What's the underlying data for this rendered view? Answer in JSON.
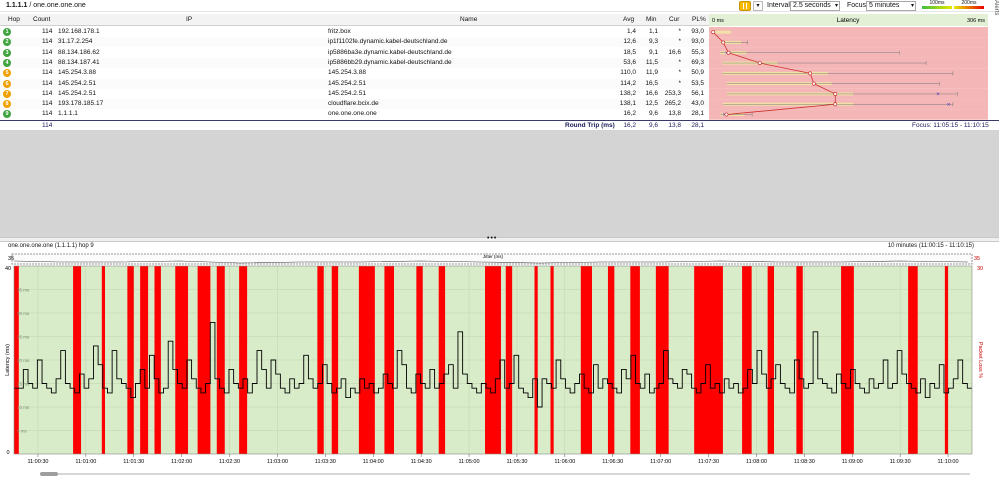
{
  "topbar": {
    "target": "1.1.1.1",
    "separator": " / ",
    "hostname": "one.one.one.one",
    "interval_label": "Interval",
    "interval_value": "2.5 seconds",
    "focus_label": "Focus",
    "focus_value": "5 minutes",
    "scale_100": "100ms",
    "scale_200": "200ms",
    "side_tab": "Alerts"
  },
  "table": {
    "headers": {
      "hop": "Hop",
      "count": "Count",
      "ip": "IP",
      "name": "Name",
      "avg": "Avg",
      "min": "Min",
      "cur": "Cur",
      "pl": "PL%"
    },
    "rows": [
      {
        "hop": "1",
        "count": "114",
        "ip": "192.168.178.1",
        "name": "fritz.box",
        "avg": "1,4",
        "min": "1,1",
        "cur": "*",
        "pl": "93,0",
        "color": "#3fa33f"
      },
      {
        "hop": "2",
        "count": "114",
        "ip": "31.17.2.254",
        "name": "ip1f1102fe.dynamic.kabel-deutschland.de",
        "avg": "12,6",
        "min": "9,3",
        "cur": "*",
        "pl": "93,0",
        "color": "#3fa33f"
      },
      {
        "hop": "3",
        "count": "114",
        "ip": "88.134.186.62",
        "name": "ip5886ba3e.dynamic.kabel-deutschland.de",
        "avg": "18,5",
        "min": "9,1",
        "cur": "16,6",
        "pl": "55,3",
        "color": "#3fa33f"
      },
      {
        "hop": "4",
        "count": "114",
        "ip": "88.134.187.41",
        "name": "ip5886bb29.dynamic.kabel-deutschland.de",
        "avg": "53,6",
        "min": "11,5",
        "cur": "*",
        "pl": "69,3",
        "color": "#3fa33f"
      },
      {
        "hop": "5",
        "count": "114",
        "ip": "145.254.3.88",
        "name": "145.254.3.88",
        "avg": "110,0",
        "min": "11,9",
        "cur": "*",
        "pl": "50,9",
        "color": "#f0a000"
      },
      {
        "hop": "6",
        "count": "114",
        "ip": "145.254.2.51",
        "name": "145.254.2.51",
        "avg": "114,2",
        "min": "16,5",
        "cur": "*",
        "pl": "53,5",
        "color": "#f0a000"
      },
      {
        "hop": "7",
        "count": "114",
        "ip": "145.254.2.51",
        "name": "145.254.2.51",
        "avg": "138,2",
        "min": "16,6",
        "cur": "253,3",
        "pl": "56,1",
        "color": "#f0a000"
      },
      {
        "hop": "8",
        "count": "114",
        "ip": "193.178.185.17",
        "name": "cloudflare.bcix.de",
        "avg": "138,1",
        "min": "12,5",
        "cur": "265,2",
        "pl": "43,0",
        "color": "#f0a000"
      },
      {
        "hop": "9",
        "count": "114",
        "ip": "1.1.1.1",
        "name": "one.one.one.one",
        "avg": "16,2",
        "min": "9,6",
        "cur": "13,8",
        "pl": "28,1",
        "color": "#3fa33f"
      }
    ],
    "footer": {
      "count": "114",
      "label": "Round Trip (ms)",
      "avg": "16,2",
      "min": "9,6",
      "cur": "13,8",
      "pl": "28,1",
      "focus_text": "Focus: 11:05:15 - 11:10:15"
    }
  },
  "latency_panel": {
    "min_label": "0 ms",
    "title": "Latency",
    "max_label": "306 ms",
    "max_ms": 306,
    "hop_avg_ms": [
      1.4,
      12.6,
      18.5,
      53.6,
      110.0,
      114.2,
      138.2,
      138.1,
      16.2
    ],
    "hop_min_ms": [
      1.1,
      9.3,
      9.1,
      11.5,
      11.9,
      16.5,
      16.6,
      12.5,
      9.6
    ],
    "hop_max_ms": [
      3,
      40,
      210,
      240,
      270,
      255,
      275,
      270,
      45
    ],
    "hop_cur_ms": [
      null,
      null,
      16.6,
      null,
      null,
      null,
      253.3,
      265.2,
      13.8
    ]
  },
  "graph": {
    "title": "one.one.one.one (1.1.1.1) hop 9",
    "range": "10 minutes (11:00:15 - 11:10:15)",
    "jitter_label": "Jitter (ms)",
    "jitter_max": "35",
    "y_left_label": "Latency (ms)",
    "y_right_label": "Packet Loss %",
    "y_top": "40",
    "y_bottom": "0",
    "y_right_top": "30",
    "y_ticks": [
      "35 ms",
      "30 ms",
      "25 ms",
      "20 ms",
      "15 ms",
      "10 ms",
      "5 ms"
    ],
    "time_labels": [
      "11:00:30",
      "11:01:00",
      "11:01:30",
      "11:02:00",
      "11:02:30",
      "11:03:00",
      "11:03:30",
      "11:04:00",
      "11:04:30",
      "11:05:00",
      "11:05:30",
      "11:06:00",
      "11:06:30",
      "11:07:00",
      "11:07:30",
      "11:08:00",
      "11:08:30",
      "11:09:00",
      "11:09:30",
      "11:10:00"
    ],
    "colors": {
      "loss": "#ff0000",
      "good_bg": "#d9ecc9",
      "line": "#000000"
    }
  },
  "chart_data": {
    "type": "line",
    "ylim": [
      0,
      40
    ],
    "xlabel": "",
    "ylabel": "Latency (ms)",
    "loss_intervals_s": [
      [
        0,
        3
      ],
      [
        37,
        42
      ],
      [
        55,
        57
      ],
      [
        71,
        75
      ],
      [
        79,
        84
      ],
      [
        88,
        92
      ],
      [
        101,
        109
      ],
      [
        115,
        123
      ],
      [
        127,
        132
      ],
      [
        141,
        146
      ],
      [
        190,
        194
      ],
      [
        199,
        203
      ],
      [
        216,
        226
      ],
      [
        232,
        238
      ],
      [
        252,
        256
      ],
      [
        266,
        270
      ],
      [
        295,
        305
      ],
      [
        308,
        312
      ],
      [
        326,
        328
      ],
      [
        336,
        338
      ],
      [
        355,
        362
      ],
      [
        372,
        376
      ],
      [
        386,
        392
      ],
      [
        402,
        410
      ],
      [
        426,
        444
      ],
      [
        456,
        462
      ],
      [
        472,
        476
      ],
      [
        490,
        494
      ],
      [
        518,
        526
      ],
      [
        560,
        566
      ],
      [
        583,
        585
      ]
    ],
    "latency_ms": [
      14,
      14,
      18,
      15,
      14,
      20,
      15,
      14,
      13,
      16,
      22,
      15,
      14,
      13,
      17,
      14,
      16,
      23,
      19,
      14,
      13,
      22,
      16,
      15,
      14,
      12,
      15,
      18,
      14,
      21,
      16,
      13,
      14,
      24,
      18,
      15,
      14,
      20,
      16,
      14,
      13,
      15,
      28,
      16,
      14,
      13,
      18,
      15,
      14,
      16,
      13,
      15,
      22,
      18,
      14,
      20,
      17,
      14,
      13,
      16,
      14,
      15,
      21,
      16,
      14,
      15,
      19,
      15,
      13,
      14,
      16,
      12,
      14,
      13,
      16,
      14,
      15,
      13,
      14,
      17,
      15,
      14,
      22,
      19,
      14,
      13,
      17,
      15,
      14,
      18,
      14,
      15,
      17,
      19,
      14,
      26,
      17,
      15,
      14,
      13,
      15,
      14,
      13,
      16,
      20,
      14,
      15,
      21,
      14,
      13,
      12,
      16,
      10,
      16,
      15,
      14,
      20,
      16,
      14,
      13,
      15,
      17,
      14,
      13,
      19,
      14,
      16,
      15,
      14,
      13,
      18,
      16,
      21,
      15,
      14,
      17,
      13,
      14,
      15,
      22,
      16,
      15,
      14,
      18,
      17,
      14,
      13,
      15,
      19,
      14,
      15,
      13,
      16,
      14,
      15,
      13,
      14,
      18,
      15,
      22,
      17,
      14,
      16,
      19,
      15,
      14,
      13,
      20,
      16,
      14,
      15,
      26,
      16,
      15,
      14,
      13,
      17,
      15,
      14,
      18,
      15,
      14,
      13,
      16,
      14,
      15,
      20,
      14,
      15,
      22,
      17,
      15,
      14,
      13,
      16,
      12,
      15,
      14,
      19,
      13,
      14,
      16,
      20,
      15,
      14
    ]
  }
}
